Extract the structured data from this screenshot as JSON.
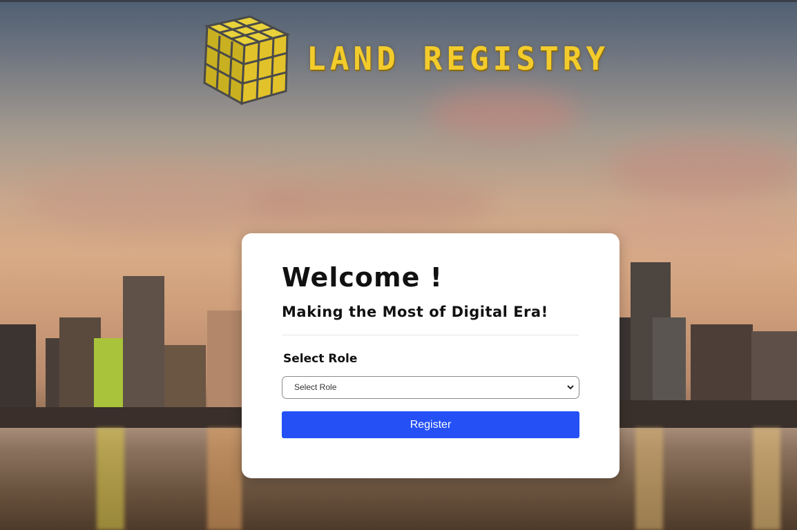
{
  "brand": {
    "title": "LAND REGISTRY",
    "logo_icon": "rubiks-cube-icon",
    "accent_color": "#f3cc2c"
  },
  "card": {
    "heading": "Welcome !",
    "subheading": "Making the Most of Digital Era!",
    "role_label": "Select Role",
    "role_select": {
      "selected": "Select Role",
      "icon": "chevron-down-icon"
    },
    "register_label": "Register",
    "button_color": "#2450f5"
  }
}
